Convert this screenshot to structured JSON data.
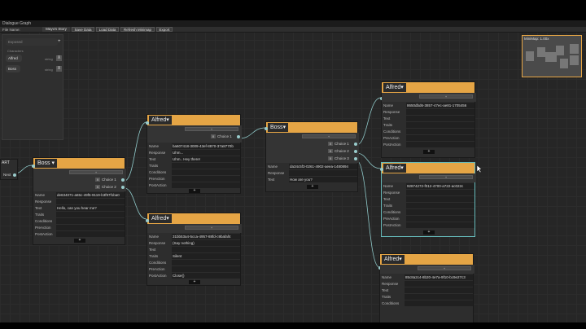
{
  "window": {
    "title": "Dialogue Graph"
  },
  "toolbar": {
    "file_name_label": "File Name:",
    "file_name_value": "Mayu's Story",
    "save": "Save Data",
    "load": "Load Data",
    "refresh": "Refresh Minimap",
    "export": "Export"
  },
  "blackboard": {
    "exposed_label": "Exposed",
    "characters_label": "Characters",
    "characters": [
      {
        "name": "Alfred",
        "type": "string",
        "remove": "X"
      },
      {
        "name": "Boss",
        "type": "string",
        "remove": "X"
      }
    ]
  },
  "minimap": {
    "title": "MiniMap: 1.00x"
  },
  "start_node": {
    "title": "ART",
    "port": "Next"
  },
  "common": {
    "add": "+",
    "remove": "X",
    "speaker_arrow": "▾"
  },
  "fields": {
    "name": "Name",
    "response": "Response",
    "text": "Text",
    "traits": "Traits",
    "conditions": "Conditions",
    "preaction": "PreAction",
    "postaction": "PostAction"
  },
  "nodes": [
    {
      "speaker": "Boss",
      "choices": [
        "Choice 1",
        "Choice 2"
      ],
      "name": "de634071-a65c-49f5-9119-b3f97f1ba0",
      "response": "",
      "text": "Hello, can you hear me?",
      "traits": "",
      "conditions": "",
      "preaction": "",
      "postaction": ""
    },
    {
      "speaker": "Alfred",
      "choices": [
        "Choice 1"
      ],
      "name": "ba607418-3009-43ef-8870-37a8770b",
      "response": "Uhm...",
      "text": "Uhm.. Hey there!",
      "traits": "",
      "conditions": "",
      "preaction": "",
      "postaction": ""
    },
    {
      "speaker": "Alfred",
      "choices": [],
      "name": "31bb53a4-5cca-4957-88fd-c9bafaf4",
      "response": "(Say nothing)",
      "text": "",
      "traits": "Silent",
      "conditions": "",
      "preaction": "",
      "postaction": "Close()"
    },
    {
      "speaker": "Boss",
      "choices": [
        "Choice 1",
        "Choice 2",
        "Choice 3"
      ],
      "name": "da34c5f3-0261-4902-aeea-1480894",
      "response": "",
      "text": "How are you?",
      "traits": "",
      "conditions": "",
      "preaction": "",
      "postaction": ""
    },
    {
      "speaker": "Alfred",
      "choices": [],
      "name": "8650dbd6-3857-47ec-ae81-1705456",
      "response": "",
      "text": "",
      "traits": "",
      "conditions": "",
      "preaction": "",
      "postaction": ""
    },
    {
      "speaker": "Alfred",
      "choices": [],
      "name": "92874272-f012-4700-a722-ac022c",
      "response": "",
      "text": "",
      "traits": "",
      "conditions": "",
      "preaction": "",
      "postaction": ""
    },
    {
      "speaker": "Alfred",
      "choices": [],
      "name": "85c8a2c4-8b20-4e7a-9f10-bc9e27c3",
      "response": "",
      "text": "",
      "traits": "",
      "conditions": "",
      "preaction": "",
      "postaction": ""
    }
  ]
}
